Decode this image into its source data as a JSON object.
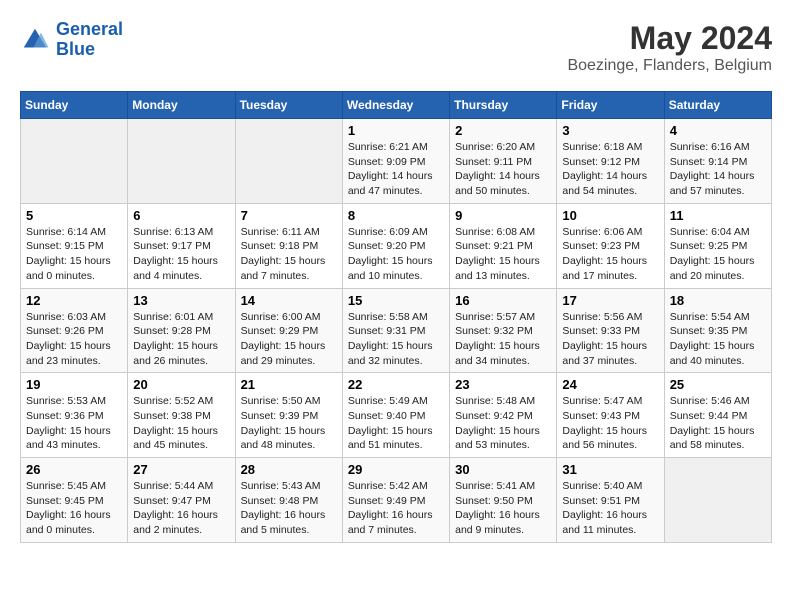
{
  "logo": {
    "line1": "General",
    "line2": "Blue"
  },
  "title": "May 2024",
  "subtitle": "Boezinge, Flanders, Belgium",
  "weekdays": [
    "Sunday",
    "Monday",
    "Tuesday",
    "Wednesday",
    "Thursday",
    "Friday",
    "Saturday"
  ],
  "weeks": [
    [
      {
        "day": "",
        "info": ""
      },
      {
        "day": "",
        "info": ""
      },
      {
        "day": "",
        "info": ""
      },
      {
        "day": "1",
        "info": "Sunrise: 6:21 AM\nSunset: 9:09 PM\nDaylight: 14 hours and 47 minutes."
      },
      {
        "day": "2",
        "info": "Sunrise: 6:20 AM\nSunset: 9:11 PM\nDaylight: 14 hours and 50 minutes."
      },
      {
        "day": "3",
        "info": "Sunrise: 6:18 AM\nSunset: 9:12 PM\nDaylight: 14 hours and 54 minutes."
      },
      {
        "day": "4",
        "info": "Sunrise: 6:16 AM\nSunset: 9:14 PM\nDaylight: 14 hours and 57 minutes."
      }
    ],
    [
      {
        "day": "5",
        "info": "Sunrise: 6:14 AM\nSunset: 9:15 PM\nDaylight: 15 hours and 0 minutes."
      },
      {
        "day": "6",
        "info": "Sunrise: 6:13 AM\nSunset: 9:17 PM\nDaylight: 15 hours and 4 minutes."
      },
      {
        "day": "7",
        "info": "Sunrise: 6:11 AM\nSunset: 9:18 PM\nDaylight: 15 hours and 7 minutes."
      },
      {
        "day": "8",
        "info": "Sunrise: 6:09 AM\nSunset: 9:20 PM\nDaylight: 15 hours and 10 minutes."
      },
      {
        "day": "9",
        "info": "Sunrise: 6:08 AM\nSunset: 9:21 PM\nDaylight: 15 hours and 13 minutes."
      },
      {
        "day": "10",
        "info": "Sunrise: 6:06 AM\nSunset: 9:23 PM\nDaylight: 15 hours and 17 minutes."
      },
      {
        "day": "11",
        "info": "Sunrise: 6:04 AM\nSunset: 9:25 PM\nDaylight: 15 hours and 20 minutes."
      }
    ],
    [
      {
        "day": "12",
        "info": "Sunrise: 6:03 AM\nSunset: 9:26 PM\nDaylight: 15 hours and 23 minutes."
      },
      {
        "day": "13",
        "info": "Sunrise: 6:01 AM\nSunset: 9:28 PM\nDaylight: 15 hours and 26 minutes."
      },
      {
        "day": "14",
        "info": "Sunrise: 6:00 AM\nSunset: 9:29 PM\nDaylight: 15 hours and 29 minutes."
      },
      {
        "day": "15",
        "info": "Sunrise: 5:58 AM\nSunset: 9:31 PM\nDaylight: 15 hours and 32 minutes."
      },
      {
        "day": "16",
        "info": "Sunrise: 5:57 AM\nSunset: 9:32 PM\nDaylight: 15 hours and 34 minutes."
      },
      {
        "day": "17",
        "info": "Sunrise: 5:56 AM\nSunset: 9:33 PM\nDaylight: 15 hours and 37 minutes."
      },
      {
        "day": "18",
        "info": "Sunrise: 5:54 AM\nSunset: 9:35 PM\nDaylight: 15 hours and 40 minutes."
      }
    ],
    [
      {
        "day": "19",
        "info": "Sunrise: 5:53 AM\nSunset: 9:36 PM\nDaylight: 15 hours and 43 minutes."
      },
      {
        "day": "20",
        "info": "Sunrise: 5:52 AM\nSunset: 9:38 PM\nDaylight: 15 hours and 45 minutes."
      },
      {
        "day": "21",
        "info": "Sunrise: 5:50 AM\nSunset: 9:39 PM\nDaylight: 15 hours and 48 minutes."
      },
      {
        "day": "22",
        "info": "Sunrise: 5:49 AM\nSunset: 9:40 PM\nDaylight: 15 hours and 51 minutes."
      },
      {
        "day": "23",
        "info": "Sunrise: 5:48 AM\nSunset: 9:42 PM\nDaylight: 15 hours and 53 minutes."
      },
      {
        "day": "24",
        "info": "Sunrise: 5:47 AM\nSunset: 9:43 PM\nDaylight: 15 hours and 56 minutes."
      },
      {
        "day": "25",
        "info": "Sunrise: 5:46 AM\nSunset: 9:44 PM\nDaylight: 15 hours and 58 minutes."
      }
    ],
    [
      {
        "day": "26",
        "info": "Sunrise: 5:45 AM\nSunset: 9:45 PM\nDaylight: 16 hours and 0 minutes."
      },
      {
        "day": "27",
        "info": "Sunrise: 5:44 AM\nSunset: 9:47 PM\nDaylight: 16 hours and 2 minutes."
      },
      {
        "day": "28",
        "info": "Sunrise: 5:43 AM\nSunset: 9:48 PM\nDaylight: 16 hours and 5 minutes."
      },
      {
        "day": "29",
        "info": "Sunrise: 5:42 AM\nSunset: 9:49 PM\nDaylight: 16 hours and 7 minutes."
      },
      {
        "day": "30",
        "info": "Sunrise: 5:41 AM\nSunset: 9:50 PM\nDaylight: 16 hours and 9 minutes."
      },
      {
        "day": "31",
        "info": "Sunrise: 5:40 AM\nSunset: 9:51 PM\nDaylight: 16 hours and 11 minutes."
      },
      {
        "day": "",
        "info": ""
      }
    ]
  ]
}
